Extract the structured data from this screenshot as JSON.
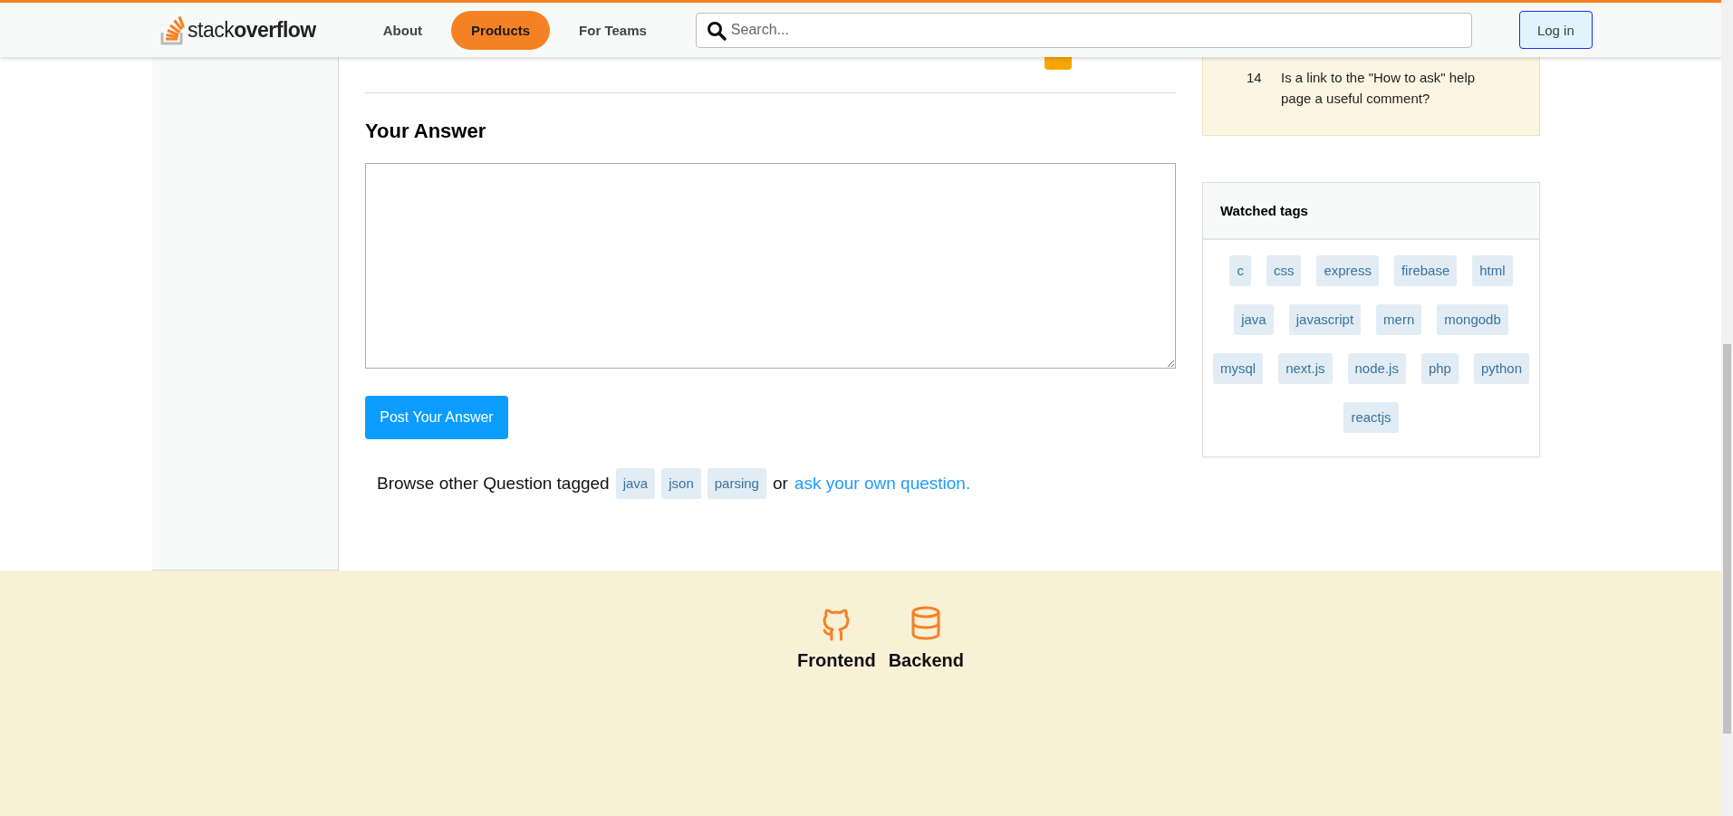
{
  "header": {
    "logo": "stack**overflow**",
    "nav": [
      {
        "label": "About",
        "selected": false
      },
      {
        "label": "Products",
        "selected": true
      },
      {
        "label": "For Teams",
        "selected": false
      }
    ],
    "search": {
      "placeholder": "Search..."
    },
    "login": "Log in"
  },
  "answer_form": {
    "heading": "Your Answer",
    "submit": "Post Your Answer",
    "browse": {
      "text": "Browse other Question tagged",
      "tags": [
        "java",
        "json",
        "parsing"
      ],
      "or": "or",
      "link": "ask your own question."
    }
  },
  "hot_meta": [
    {
      "count": "14",
      "title": "Is a link to the \"How to ask\" help page a useful comment?"
    }
  ],
  "watched_tags": {
    "title": "Watched tags",
    "tags": [
      "c",
      "css",
      "express",
      "firebase",
      "html",
      "java",
      "javascript",
      "mern",
      "mongodb",
      "mysql",
      "next.js",
      "node.js",
      "php",
      "python",
      "reactjs"
    ]
  },
  "footer": {
    "links": [
      {
        "label": "Frontend",
        "kind": "github"
      },
      {
        "label": "Backend",
        "kind": "database"
      }
    ]
  }
}
